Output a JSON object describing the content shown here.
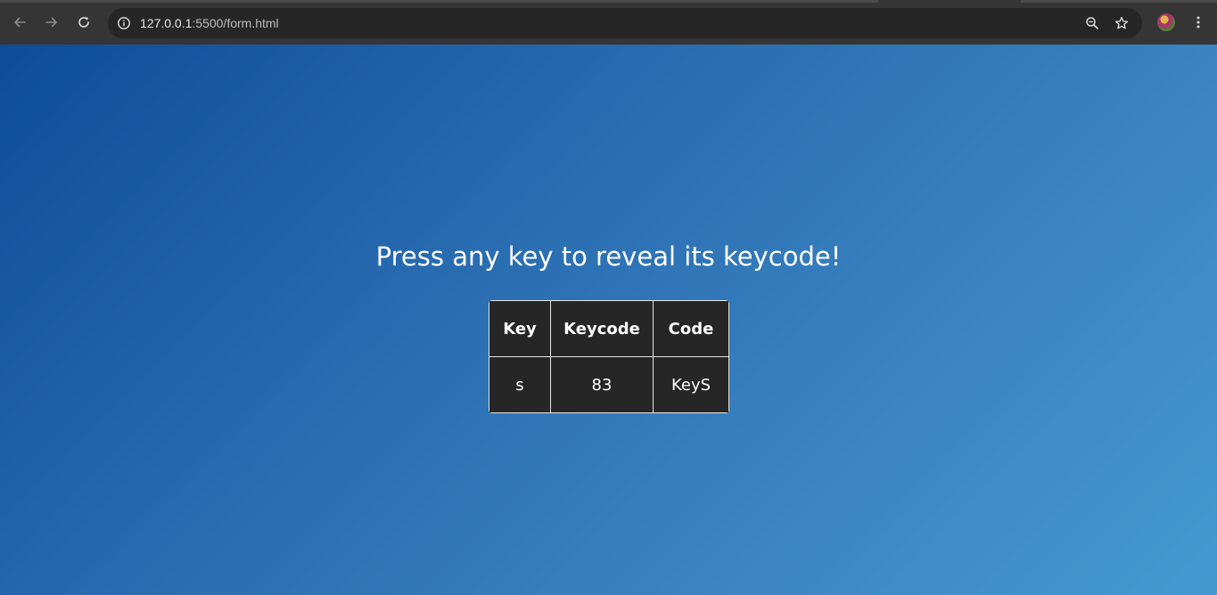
{
  "browser": {
    "url_host": "127.0.0.1",
    "url_path": ":5500/form.html",
    "icons": {
      "back": "back-arrow-icon",
      "forward": "forward-arrow-icon",
      "reload": "reload-icon",
      "site_info": "info-icon",
      "zoom": "zoom-icon",
      "bookmark": "star-icon",
      "profile": "avatar",
      "menu": "kebab-menu-icon"
    }
  },
  "page": {
    "headline": "Press any key to reveal its keycode!",
    "table": {
      "headers": [
        "Key",
        "Keycode",
        "Code"
      ],
      "row": [
        "s",
        "83",
        "KeyS"
      ]
    }
  },
  "colors": {
    "gradient_start": "#0d4d98",
    "gradient_end": "#4599d1",
    "table_bg": "#262626",
    "chrome_bg": "#353535"
  }
}
